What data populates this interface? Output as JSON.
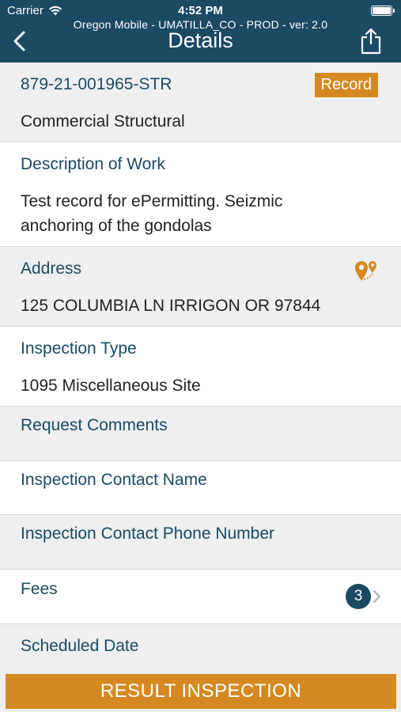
{
  "status_bar": {
    "carrier": "Carrier",
    "time": "4:52 PM"
  },
  "header": {
    "environment": "Oregon Mobile - UMATILLA_CO - PROD - ver: 2.0",
    "title": "Details"
  },
  "record": {
    "number": "879-21-001965-STR",
    "badge": "Record",
    "type": "Commercial Structural"
  },
  "description": {
    "label": "Description of Work",
    "value": "Test record for ePermitting. Seizmic anchoring of the gondolas"
  },
  "address": {
    "label": "Address",
    "value": "125 COLUMBIA LN IRRIGON OR 97844"
  },
  "inspection_type": {
    "label": "Inspection Type",
    "value": "1095 Miscellaneous Site"
  },
  "request_comments": {
    "label": "Request Comments"
  },
  "contact_name": {
    "label": "Inspection Contact Name"
  },
  "contact_phone": {
    "label": "Inspection Contact Phone Number"
  },
  "fees": {
    "label": "Fees",
    "count": "3"
  },
  "scheduled_date": {
    "label": "Scheduled Date"
  },
  "actions": {
    "result_inspection": "RESULT INSPECTION"
  },
  "colors": {
    "header": "#1b4a63",
    "accent": "#d48a21",
    "label": "#1b4a63"
  },
  "icons": [
    "wifi-icon",
    "battery-icon",
    "back-chevron-icon",
    "share-icon",
    "map-pin-icon",
    "chevron-right-icon"
  ]
}
